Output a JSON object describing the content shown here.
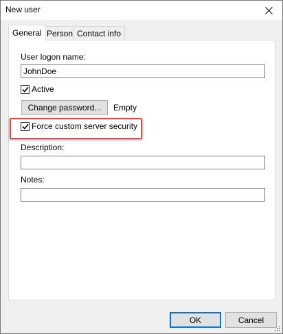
{
  "window": {
    "title": "New user"
  },
  "tabs": [
    {
      "label": "General"
    },
    {
      "label": "Person"
    },
    {
      "label": "Contact info"
    }
  ],
  "general": {
    "logon_label": "User logon name:",
    "logon_value": "JohnDoe",
    "active_label": "Active",
    "active_checked": true,
    "change_password_label": "Change password...",
    "password_status": "Empty",
    "force_security_label": "Force custom server security",
    "force_security_checked": true,
    "description_label": "Description:",
    "description_value": "",
    "notes_label": "Notes:",
    "notes_value": ""
  },
  "buttons": {
    "ok": "OK",
    "cancel": "Cancel"
  },
  "annotation": {
    "highlight_color": "#e8474b"
  },
  "icons": [
    "close-icon",
    "checkmark-icon",
    "size-grip-icon"
  ]
}
